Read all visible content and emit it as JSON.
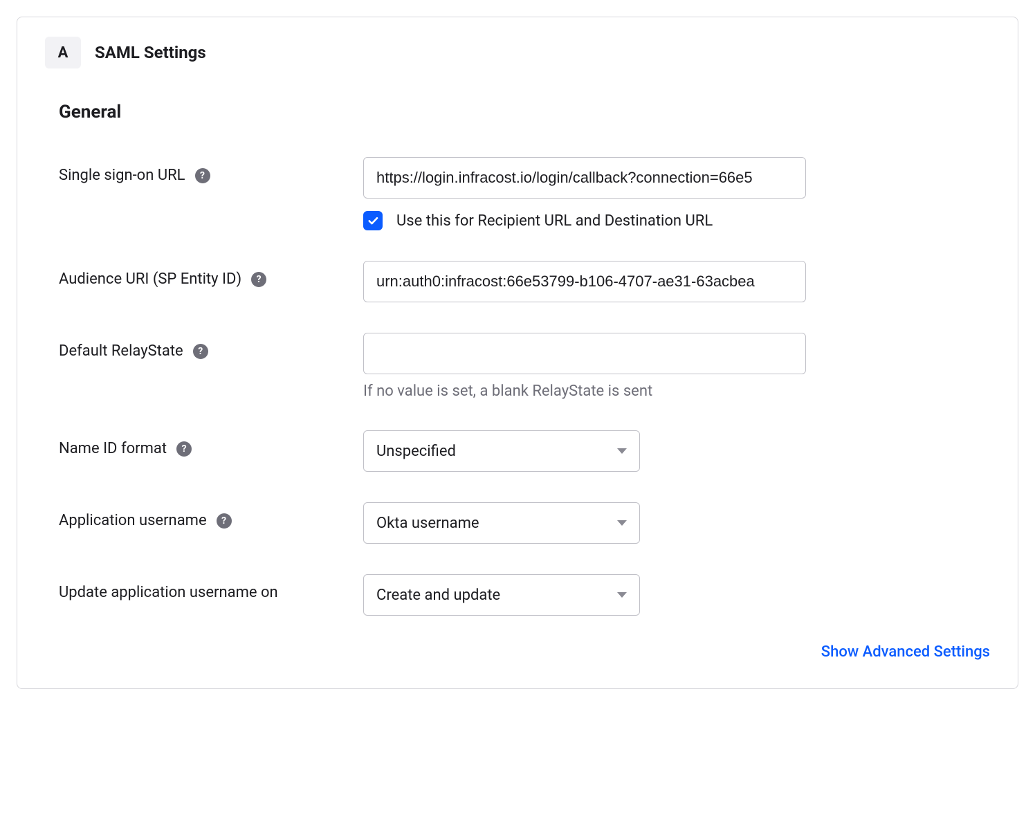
{
  "header": {
    "step_letter": "A",
    "title": "SAML Settings"
  },
  "section": {
    "title": "General"
  },
  "fields": {
    "sso_url": {
      "label": "Single sign-on URL",
      "value": "https://login.infracost.io/login/callback?connection=66e5",
      "checkbox_label": "Use this for Recipient URL and Destination URL",
      "checkbox_checked": true
    },
    "audience_uri": {
      "label": "Audience URI (SP Entity ID)",
      "value": "urn:auth0:infracost:66e53799-b106-4707-ae31-63acbea"
    },
    "relay_state": {
      "label": "Default RelayState",
      "value": "",
      "hint": "If no value is set, a blank RelayState is sent"
    },
    "name_id_format": {
      "label": "Name ID format",
      "value": "Unspecified"
    },
    "app_username": {
      "label": "Application username",
      "value": "Okta username"
    },
    "update_username_on": {
      "label": "Update application username on",
      "value": "Create and update"
    }
  },
  "advanced_link": "Show Advanced Settings"
}
